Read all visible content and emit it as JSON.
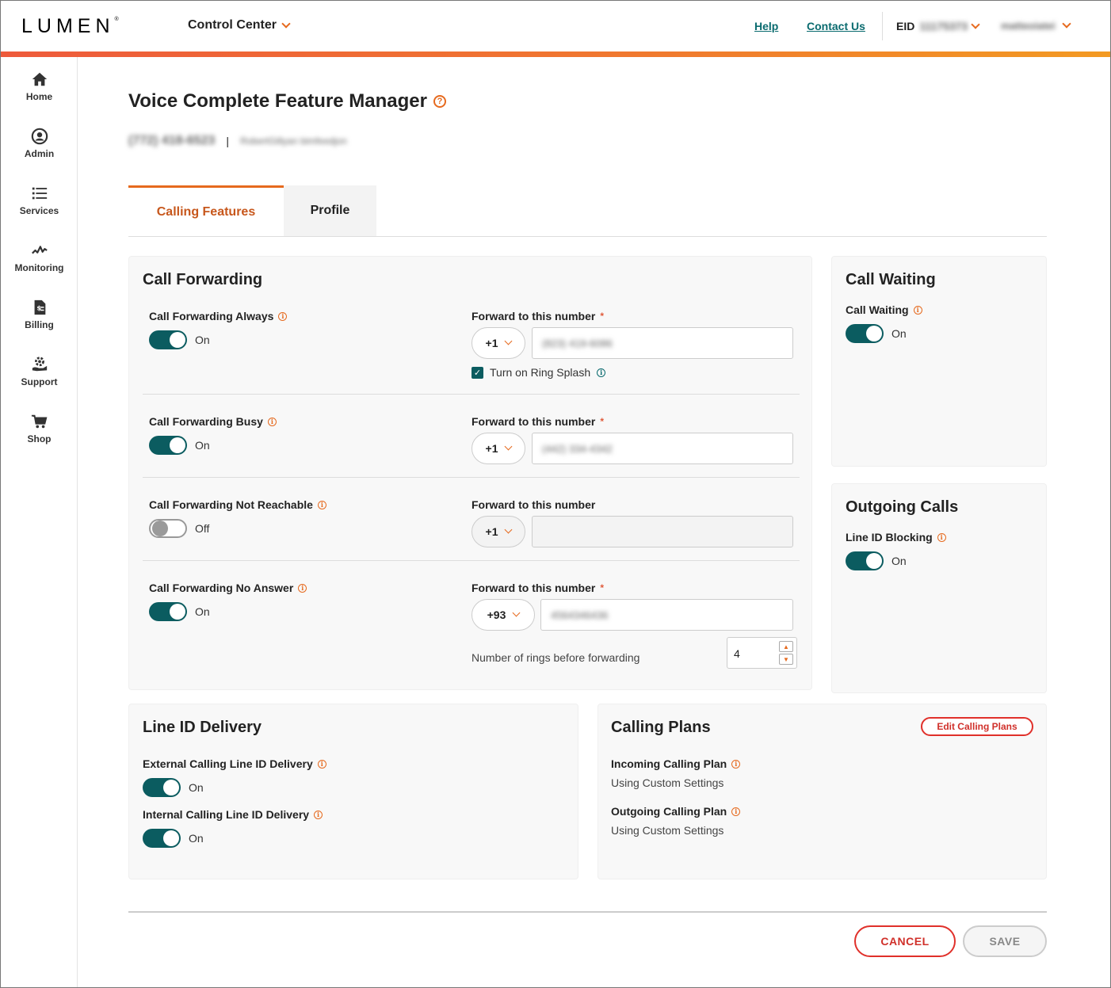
{
  "header": {
    "logo": "LUMEN",
    "logo_mark": "®",
    "app_menu": "Control Center",
    "help": "Help",
    "contact": "Contact Us",
    "eid_label": "EID",
    "eid_value": "11175373",
    "user": "matteoiatei"
  },
  "sidebar": {
    "items": [
      {
        "label": "Home",
        "icon": "home-icon"
      },
      {
        "label": "Admin",
        "icon": "user-icon"
      },
      {
        "label": "Services",
        "icon": "list-icon"
      },
      {
        "label": "Monitoring",
        "icon": "pulse-icon"
      },
      {
        "label": "Billing",
        "icon": "invoice-icon"
      },
      {
        "label": "Support",
        "icon": "support-icon"
      },
      {
        "label": "Shop",
        "icon": "cart-icon"
      }
    ]
  },
  "page": {
    "title": "Voice Complete Feature Manager",
    "phone": "(772) 418-6523",
    "account": "RobertGillyan bimfeedjon",
    "separator": "|"
  },
  "tabs": [
    {
      "label": "Calling Features",
      "active": true
    },
    {
      "label": "Profile",
      "active": false
    }
  ],
  "call_forwarding": {
    "title": "Call Forwarding",
    "rows": [
      {
        "label": "Call Forwarding Always",
        "state": "On",
        "on": true,
        "fwd_label": "Forward to this number",
        "required": "*",
        "code": "+1",
        "number": "(823) 419-6086"
      },
      {
        "label": "Call Forwarding Busy",
        "state": "On",
        "on": true,
        "fwd_label": "Forward to this number",
        "required": "*",
        "code": "+1",
        "number": "(442) 334-4342"
      },
      {
        "label": "Call Forwarding Not Reachable",
        "state": "Off",
        "on": false,
        "fwd_label": "Forward to this number",
        "required": "",
        "code": "+1",
        "number": ""
      },
      {
        "label": "Call Forwarding No Answer",
        "state": "On",
        "on": true,
        "fwd_label": "Forward to this number",
        "required": "*",
        "code": "+93",
        "number": "4564346436"
      }
    ],
    "ring_splash": "Turn on Ring Splash",
    "rings_label": "Number of rings before forwarding",
    "rings_value": "4"
  },
  "call_waiting": {
    "title": "Call Waiting",
    "label": "Call Waiting",
    "state": "On"
  },
  "outgoing_calls": {
    "title": "Outgoing Calls",
    "label": "Line ID Blocking",
    "state": "On"
  },
  "line_id_delivery": {
    "title": "Line ID Delivery",
    "external_label": "External Calling Line ID Delivery",
    "external_state": "On",
    "internal_label": "Internal Calling Line ID Delivery",
    "internal_state": "On"
  },
  "calling_plans": {
    "title": "Calling Plans",
    "edit": "Edit Calling Plans",
    "incoming_label": "Incoming Calling Plan",
    "incoming_value": "Using Custom Settings",
    "outgoing_label": "Outgoing Calling Plan",
    "outgoing_value": "Using Custom Settings"
  },
  "actions": {
    "cancel": "CANCEL",
    "save": "SAVE"
  },
  "colors": {
    "accent": "#e66a1e",
    "toggle_on": "#0b5c60",
    "danger": "#e0302a",
    "link": "#0a6b6f"
  }
}
